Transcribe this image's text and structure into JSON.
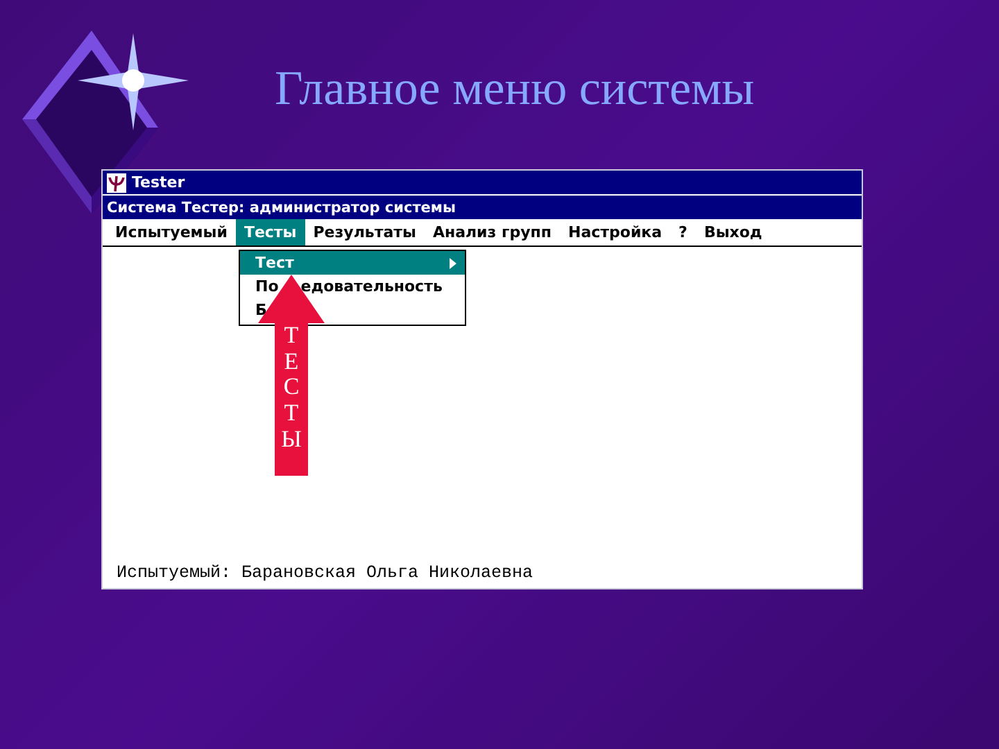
{
  "slide_title": "Главное меню системы",
  "window": {
    "title": "Tester",
    "subtitle": "Система Тестер: администратор системы"
  },
  "menu": [
    {
      "label": "Испытуемый",
      "selected": false
    },
    {
      "label": "Тесты",
      "selected": true
    },
    {
      "label": "Результаты",
      "selected": false
    },
    {
      "label": "Анализ групп",
      "selected": false
    },
    {
      "label": "Настройка",
      "selected": false
    },
    {
      "label": "?",
      "selected": false
    },
    {
      "label": "Выход",
      "selected": false
    }
  ],
  "dropdown": [
    {
      "label": "Тест",
      "selected": true,
      "submenu": true
    },
    {
      "label": "По",
      "label_rest": "едовательность",
      "selected": false,
      "submenu": false
    },
    {
      "label": "Б",
      "selected": false,
      "submenu": false
    }
  ],
  "arrow_label": "ТЕСТЫ",
  "status": "Испытуемый: Барановская Ольга Николаевна"
}
